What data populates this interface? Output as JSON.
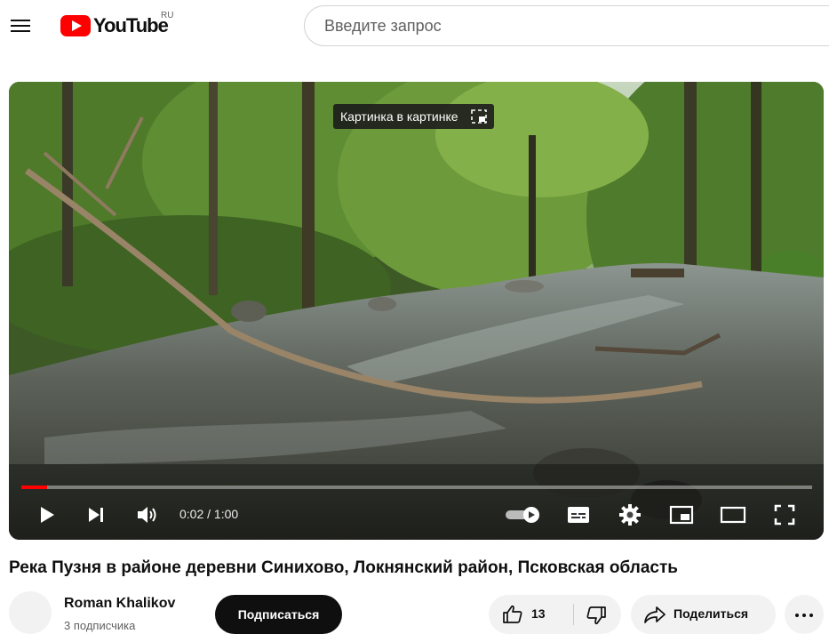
{
  "header": {
    "logo_text": "YouTube",
    "region": "RU",
    "search_placeholder": "Введите запрос"
  },
  "player": {
    "tooltip": "Картинка в картинке",
    "time": "0:02 / 1:00",
    "progress": 0.033,
    "accent_color": "#ff0000"
  },
  "video": {
    "title": "Река Пузня в районе деревни Синихово, Локнянский район, Псковская область"
  },
  "channel": {
    "name": "Roman Khalikov",
    "subscribers": "3 подписчика"
  },
  "actions": {
    "subscribe_label": "Подписаться",
    "like_count": "13",
    "share_label": "Поделиться"
  }
}
